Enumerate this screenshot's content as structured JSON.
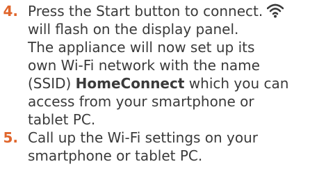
{
  "colors": {
    "step_number": "#e0662c",
    "text": "#3a3a3a"
  },
  "steps": [
    {
      "number": "4.",
      "line1": "Press the Start button to connect.",
      "icon": "wifi-icon",
      "line2": "will flash on the display panel.",
      "line3": "The appliance will now set up its",
      "line4": "own Wi-Fi network with the name",
      "line5_pre": "(SSID) ",
      "line5_bold": "HomeConnect",
      "line5_post": " which you can",
      "line6": "access from your smartphone or",
      "line7": "tablet PC."
    },
    {
      "number": "5.",
      "line1": "Call up the Wi-Fi settings on your",
      "line2": "smartphone or tablet PC."
    }
  ]
}
